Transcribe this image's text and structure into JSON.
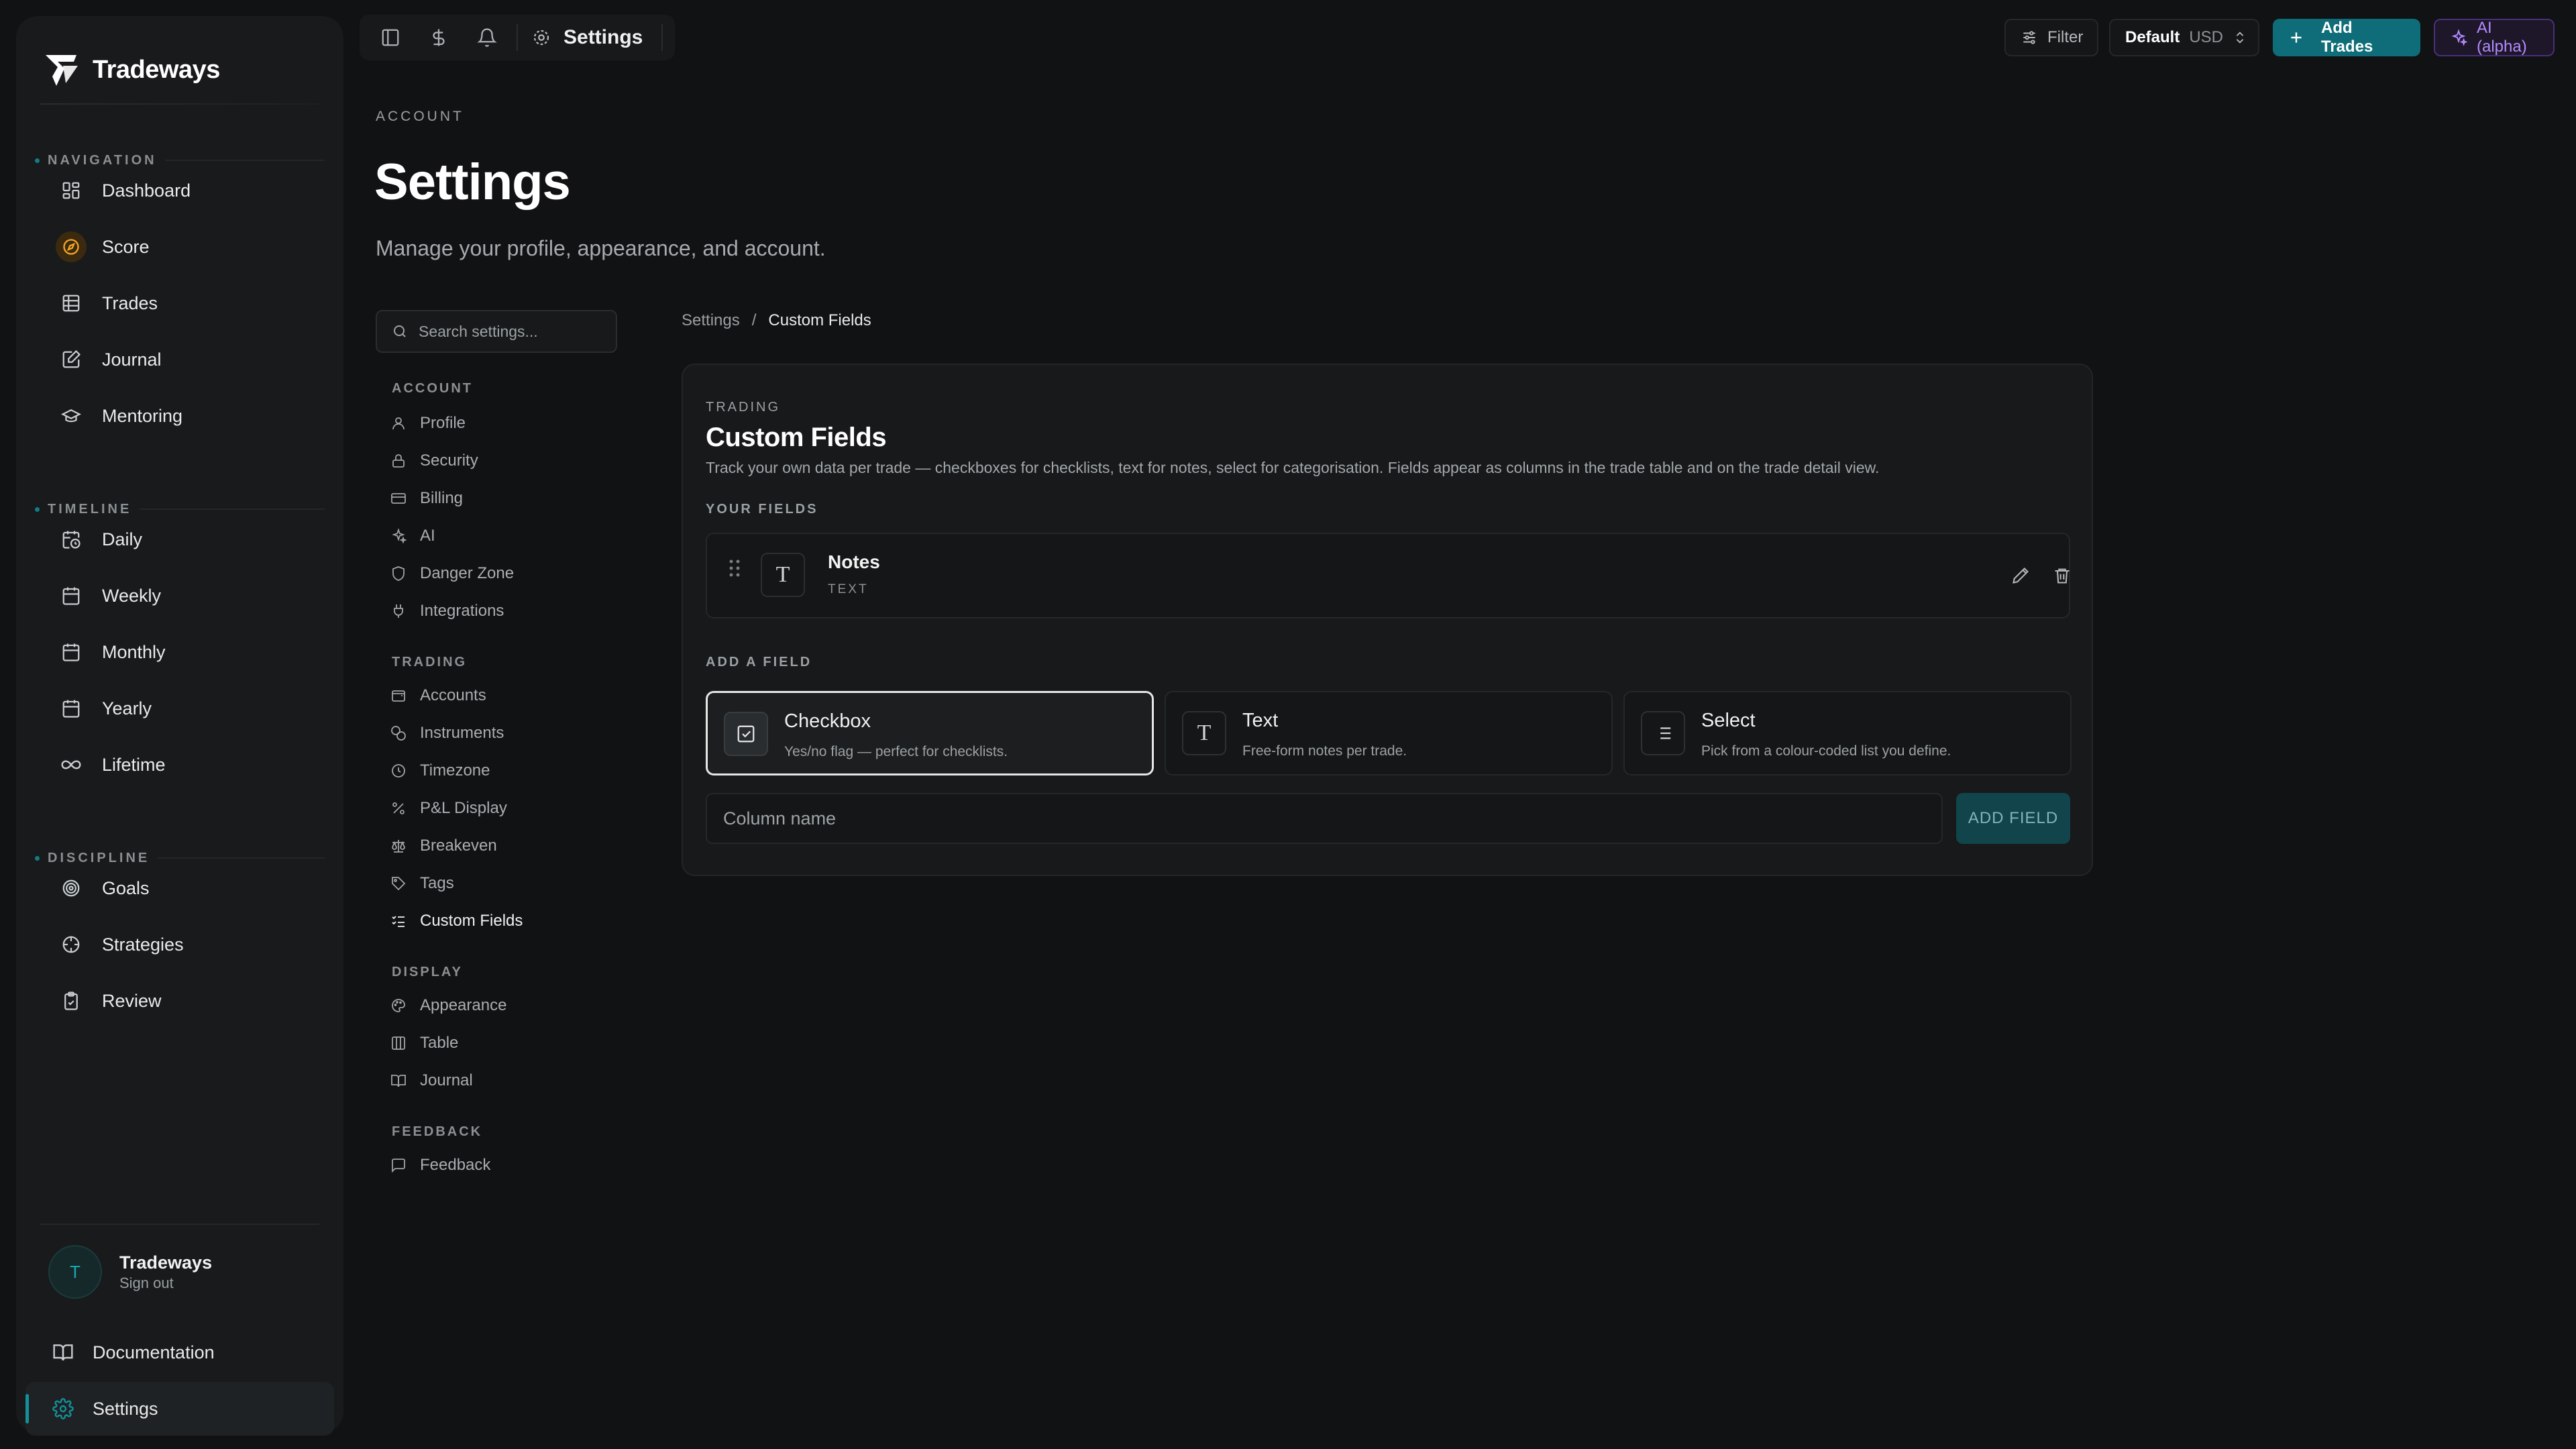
{
  "app": {
    "name": "Tradeways"
  },
  "sidebar": {
    "sections": [
      {
        "label": "NAVIGATION",
        "items": [
          {
            "label": "Dashboard",
            "icon": "dashboard-icon"
          },
          {
            "label": "Score",
            "icon": "compass-icon"
          },
          {
            "label": "Trades",
            "icon": "table-icon"
          },
          {
            "label": "Journal",
            "icon": "journal-icon"
          },
          {
            "label": "Mentoring",
            "icon": "graduation-cap-icon"
          }
        ]
      },
      {
        "label": "TIMELINE",
        "items": [
          {
            "label": "Daily",
            "icon": "calendar-clock-icon"
          },
          {
            "label": "Weekly",
            "icon": "calendar-icon"
          },
          {
            "label": "Monthly",
            "icon": "calendar-icon"
          },
          {
            "label": "Yearly",
            "icon": "calendar-icon"
          },
          {
            "label": "Lifetime",
            "icon": "infinity-icon"
          }
        ]
      },
      {
        "label": "DISCIPLINE",
        "items": [
          {
            "label": "Goals",
            "icon": "target-icon"
          },
          {
            "label": "Strategies",
            "icon": "crosshair-icon"
          },
          {
            "label": "Review",
            "icon": "clipboard-check-icon"
          }
        ]
      }
    ],
    "user": {
      "initial": "T",
      "name": "Tradeways",
      "sub": "Sign out"
    },
    "documentation": "Documentation",
    "settings": "Settings"
  },
  "topbar": {
    "title": "Settings",
    "filter": "Filter",
    "account": "Default",
    "currency": "USD",
    "add_trades": "Add Trades",
    "ai": "AI (alpha)"
  },
  "header": {
    "eyebrow": "ACCOUNT",
    "title": "Settings",
    "subtitle": "Manage your profile, appearance, and account."
  },
  "settings_nav": {
    "search_placeholder": "Search settings...",
    "groups": [
      {
        "label": "ACCOUNT",
        "items": [
          "Profile",
          "Security",
          "Billing",
          "AI",
          "Danger Zone",
          "Integrations"
        ]
      },
      {
        "label": "TRADING",
        "items": [
          "Accounts",
          "Instruments",
          "Timezone",
          "P&L Display",
          "Breakeven",
          "Tags",
          "Custom Fields"
        ]
      },
      {
        "label": "DISPLAY",
        "items": [
          "Appearance",
          "Table",
          "Journal"
        ]
      },
      {
        "label": "FEEDBACK",
        "items": [
          "Feedback"
        ]
      }
    ],
    "active": "Custom Fields"
  },
  "breadcrumb": {
    "root": "Settings",
    "sep": "/",
    "current": "Custom Fields"
  },
  "card": {
    "eyebrow": "TRADING",
    "title": "Custom Fields",
    "description": "Track your own data per trade — checkboxes for checklists, text for notes, select for categorisation. Fields appear as columns in the trade table and on the trade detail view.",
    "your_fields_label": "YOUR FIELDS",
    "fields": [
      {
        "name": "Notes",
        "type": "TEXT",
        "glyph": "T"
      }
    ],
    "add_field_label": "ADD A FIELD",
    "types": [
      {
        "name": "Checkbox",
        "desc": "Yes/no flag — perfect for checklists.",
        "selected": true
      },
      {
        "name": "Text",
        "desc": "Free-form notes per trade.",
        "glyph": "T"
      },
      {
        "name": "Select",
        "desc": "Pick from a colour-coded list you define."
      }
    ],
    "column_placeholder": "Column name",
    "add_button": "ADD FIELD"
  },
  "colors": {
    "accent": "#0e6d78",
    "ai": "#b48cff",
    "score": "#f5a623"
  }
}
